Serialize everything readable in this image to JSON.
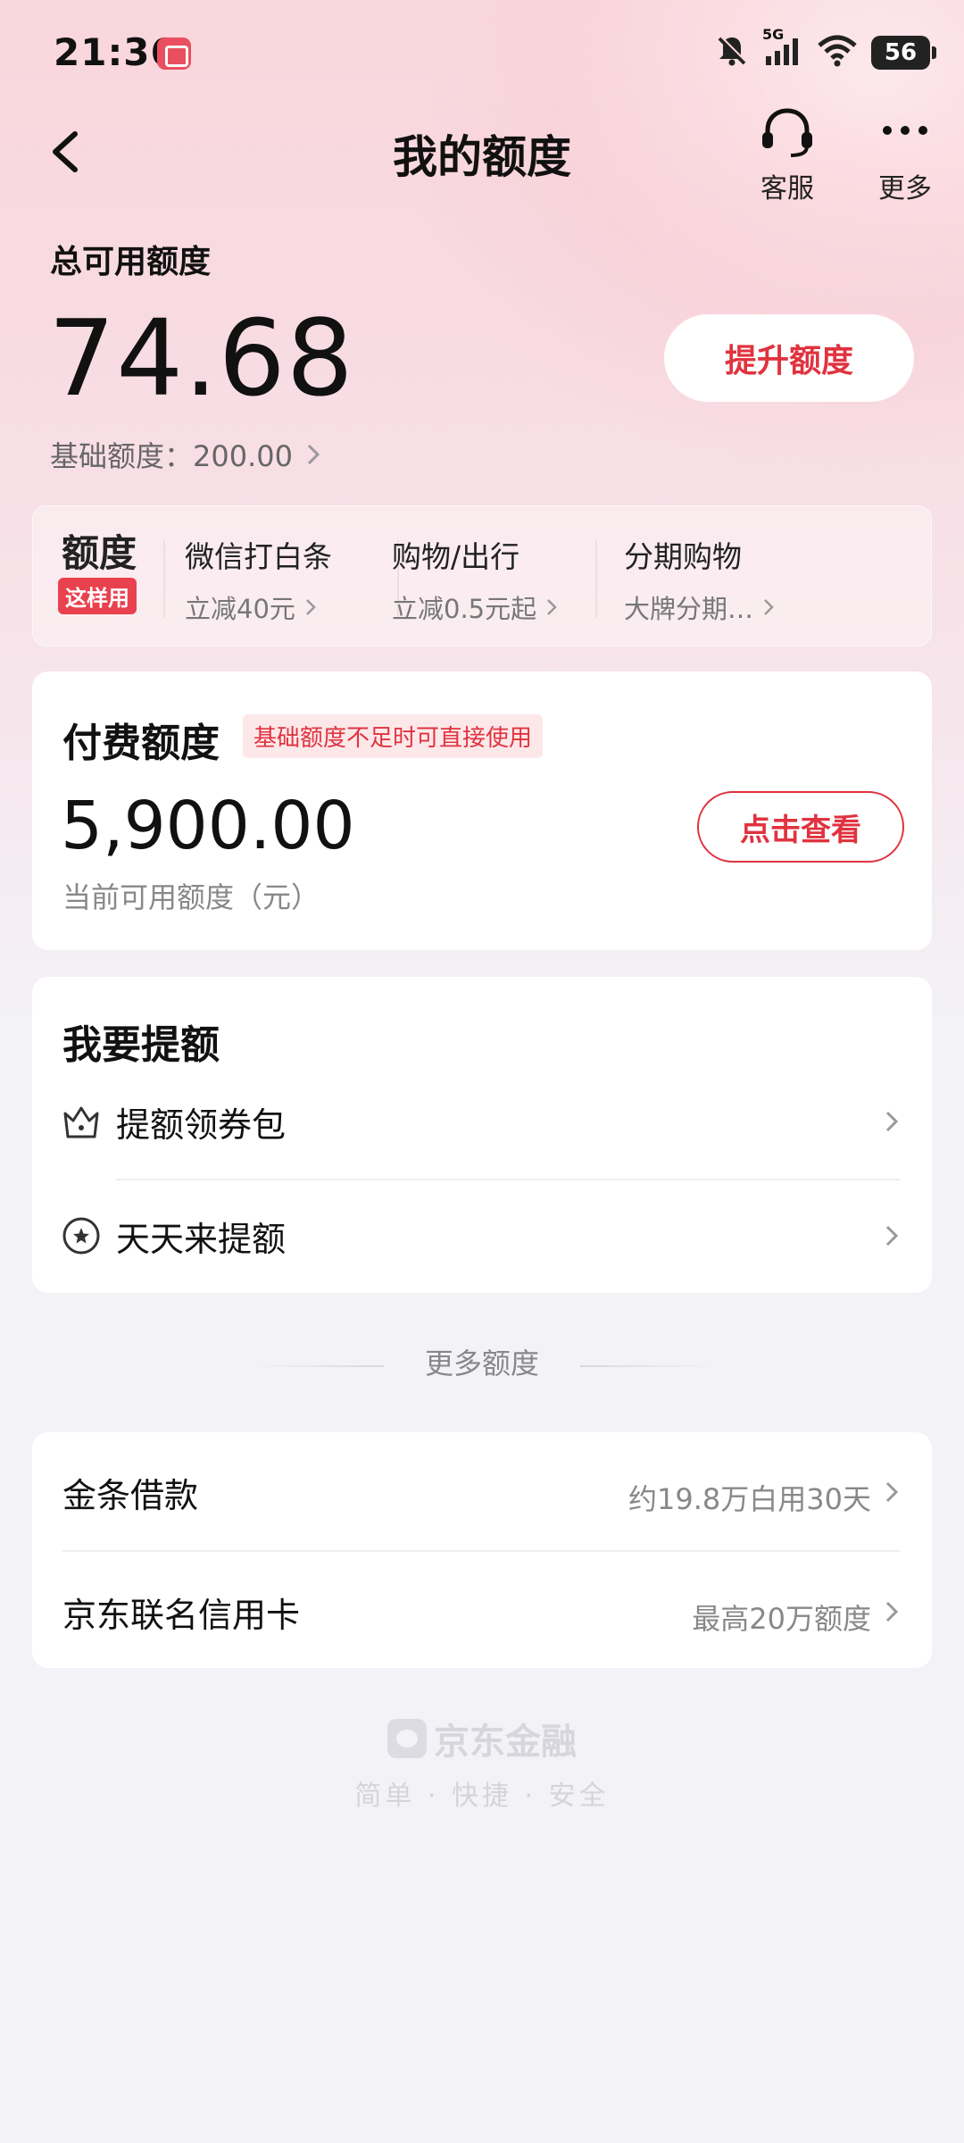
{
  "status_bar": {
    "time": "21:36",
    "network": "5G",
    "battery": "56"
  },
  "nav": {
    "title": "我的额度",
    "service_label": "客服",
    "more_label": "更多"
  },
  "total": {
    "label": "总可用额度",
    "amount": "74.68",
    "raise_button": "提升额度",
    "base_label": "基础额度：200.00"
  },
  "promo": {
    "badge_title": "额度",
    "badge_tag": "这样用",
    "items": [
      {
        "title": "微信打白条",
        "sub": "立减40元"
      },
      {
        "title": "购物/出行",
        "sub": "立减0.5元起"
      },
      {
        "title": "分期购物",
        "sub": "大牌分期…"
      }
    ]
  },
  "paid": {
    "title": "付费额度",
    "tag": "基础额度不足时可直接使用",
    "amount": "5,900.00",
    "sub": "当前可用额度（元）",
    "button": "点击查看"
  },
  "raise": {
    "title": "我要提额",
    "items": [
      {
        "label": "提额领券包"
      },
      {
        "label": "天天来提额"
      }
    ]
  },
  "more": {
    "header": "更多额度",
    "items": [
      {
        "label": "金条借款",
        "value": "约19.8万白用30天"
      },
      {
        "label": "京东联名信用卡",
        "value": "最高20万额度"
      }
    ]
  },
  "footer": {
    "brand": "京东金融",
    "slogan": "简单 · 快捷 · 安全"
  },
  "colors": {
    "accent": "#e0333f",
    "badge": "#e9414e",
    "page_bg": "#f3f2f7",
    "header_bg": "#f9d6dc"
  }
}
